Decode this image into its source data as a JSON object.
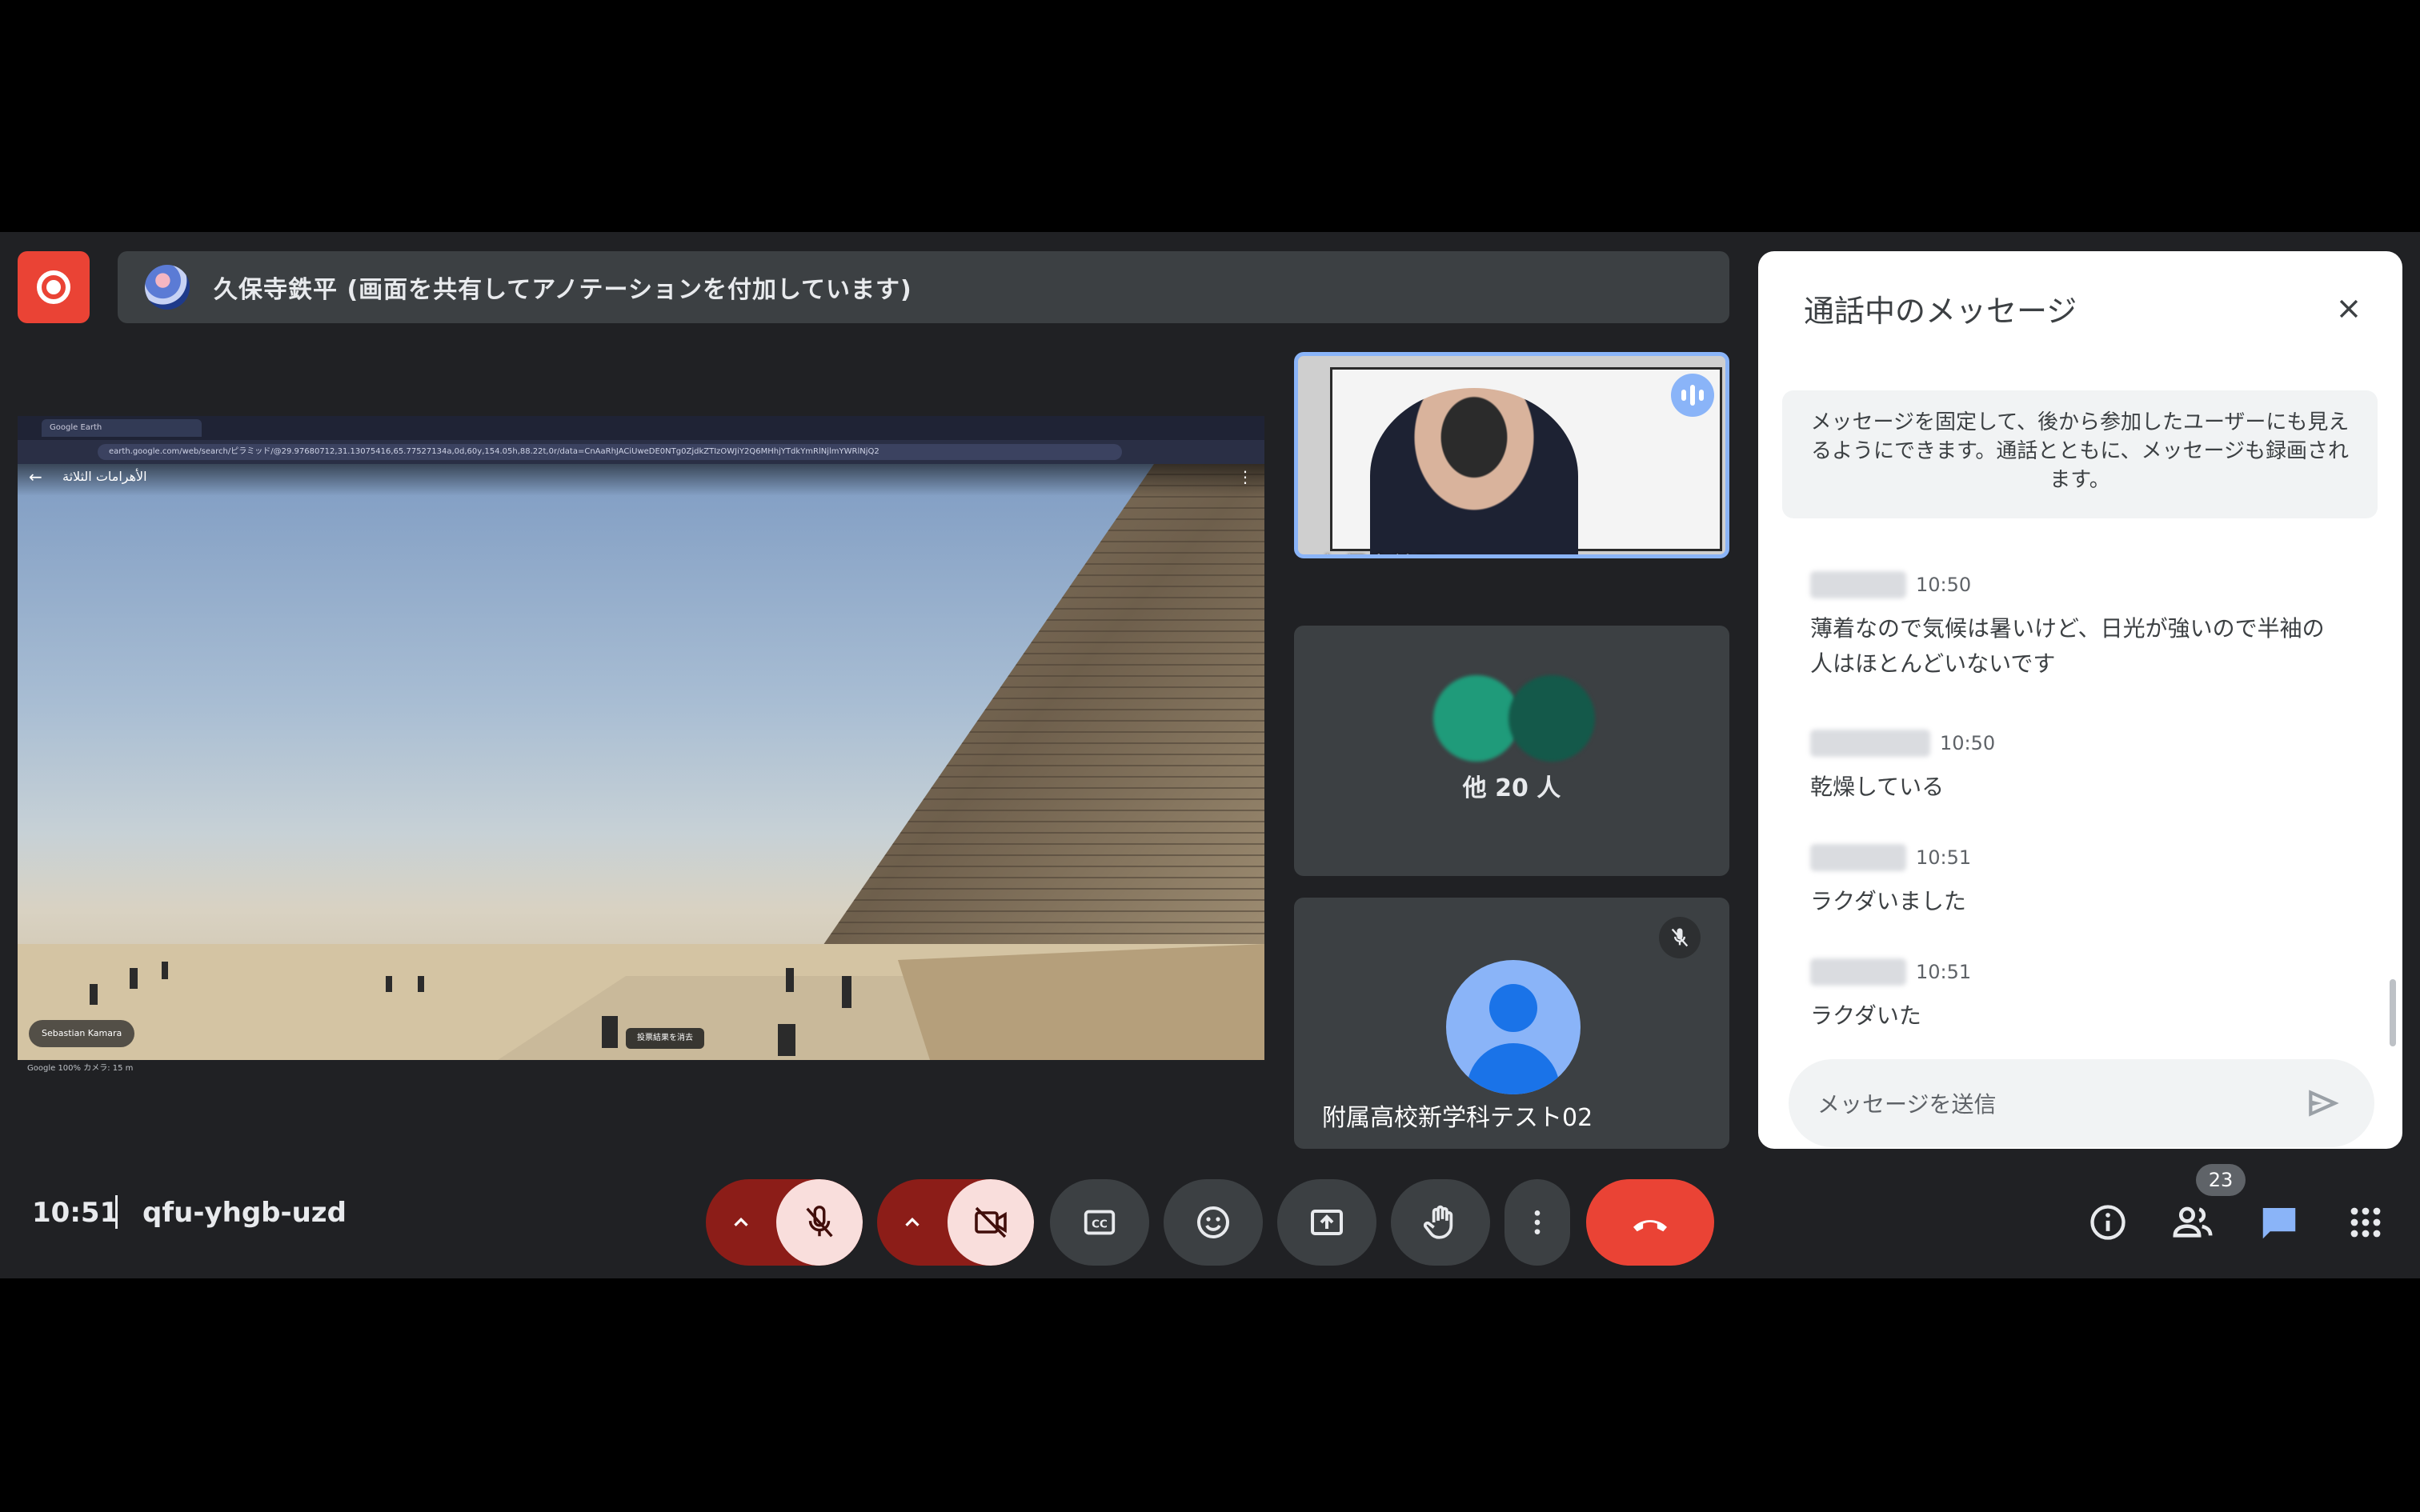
{
  "recording": {
    "icon": "record-icon"
  },
  "presenter": {
    "label": "久保寺鉄平 (画面を共有してアノテーションを付加しています)"
  },
  "shared_screen": {
    "browser_tab": "Google Earth",
    "url": "earth.google.com/web/search/ピラミッド/@29.97680712,31.13075416,65.77527134a,0d,60y,154.05h,88.22t,0r/data=CnAaRhJACiUweDE0NTg0ZjdkZTIzOWJiY2Q6MHhjYTdkYmRlNjlmYWRlNjQ2",
    "place_title": "الأهرامات الثلاثة",
    "author": "Sebastian Kamara",
    "close_chip": "投票結果を消去",
    "footer": "Google   100%   カメラ: 15 m"
  },
  "tiles": {
    "speaker_name": "久保寺鉄平",
    "others_label": "他 20 人",
    "participant_name": "附属高校新学科テスト02"
  },
  "chat": {
    "title": "通話中のメッセージ",
    "info": "メッセージを固定して、後から参加したユーザーにも見えるようにできます。通話とともに、メッセージも録画されます。",
    "messages": [
      {
        "time": "10:50",
        "text": "薄着なので気候は暑いけど、日光が強いので半袖の人はほとんどいないです"
      },
      {
        "time": "10:50",
        "text": "乾燥している"
      },
      {
        "time": "10:51",
        "text": "ラクダいました"
      },
      {
        "time": "10:51",
        "text": "ラクダいた"
      }
    ],
    "input_placeholder": "メッセージを送信"
  },
  "meeting": {
    "time": "10:51",
    "code": "qfu-yhgb-uzd"
  },
  "controls": {
    "people_count": "23"
  },
  "colors": {
    "accent": "#8ab4f8",
    "danger": "#ea4335",
    "panel_dark": "#202124",
    "tile": "#3c4043",
    "mic_off_bg": "#f9dedc",
    "split_bg": "#8c1d18"
  }
}
